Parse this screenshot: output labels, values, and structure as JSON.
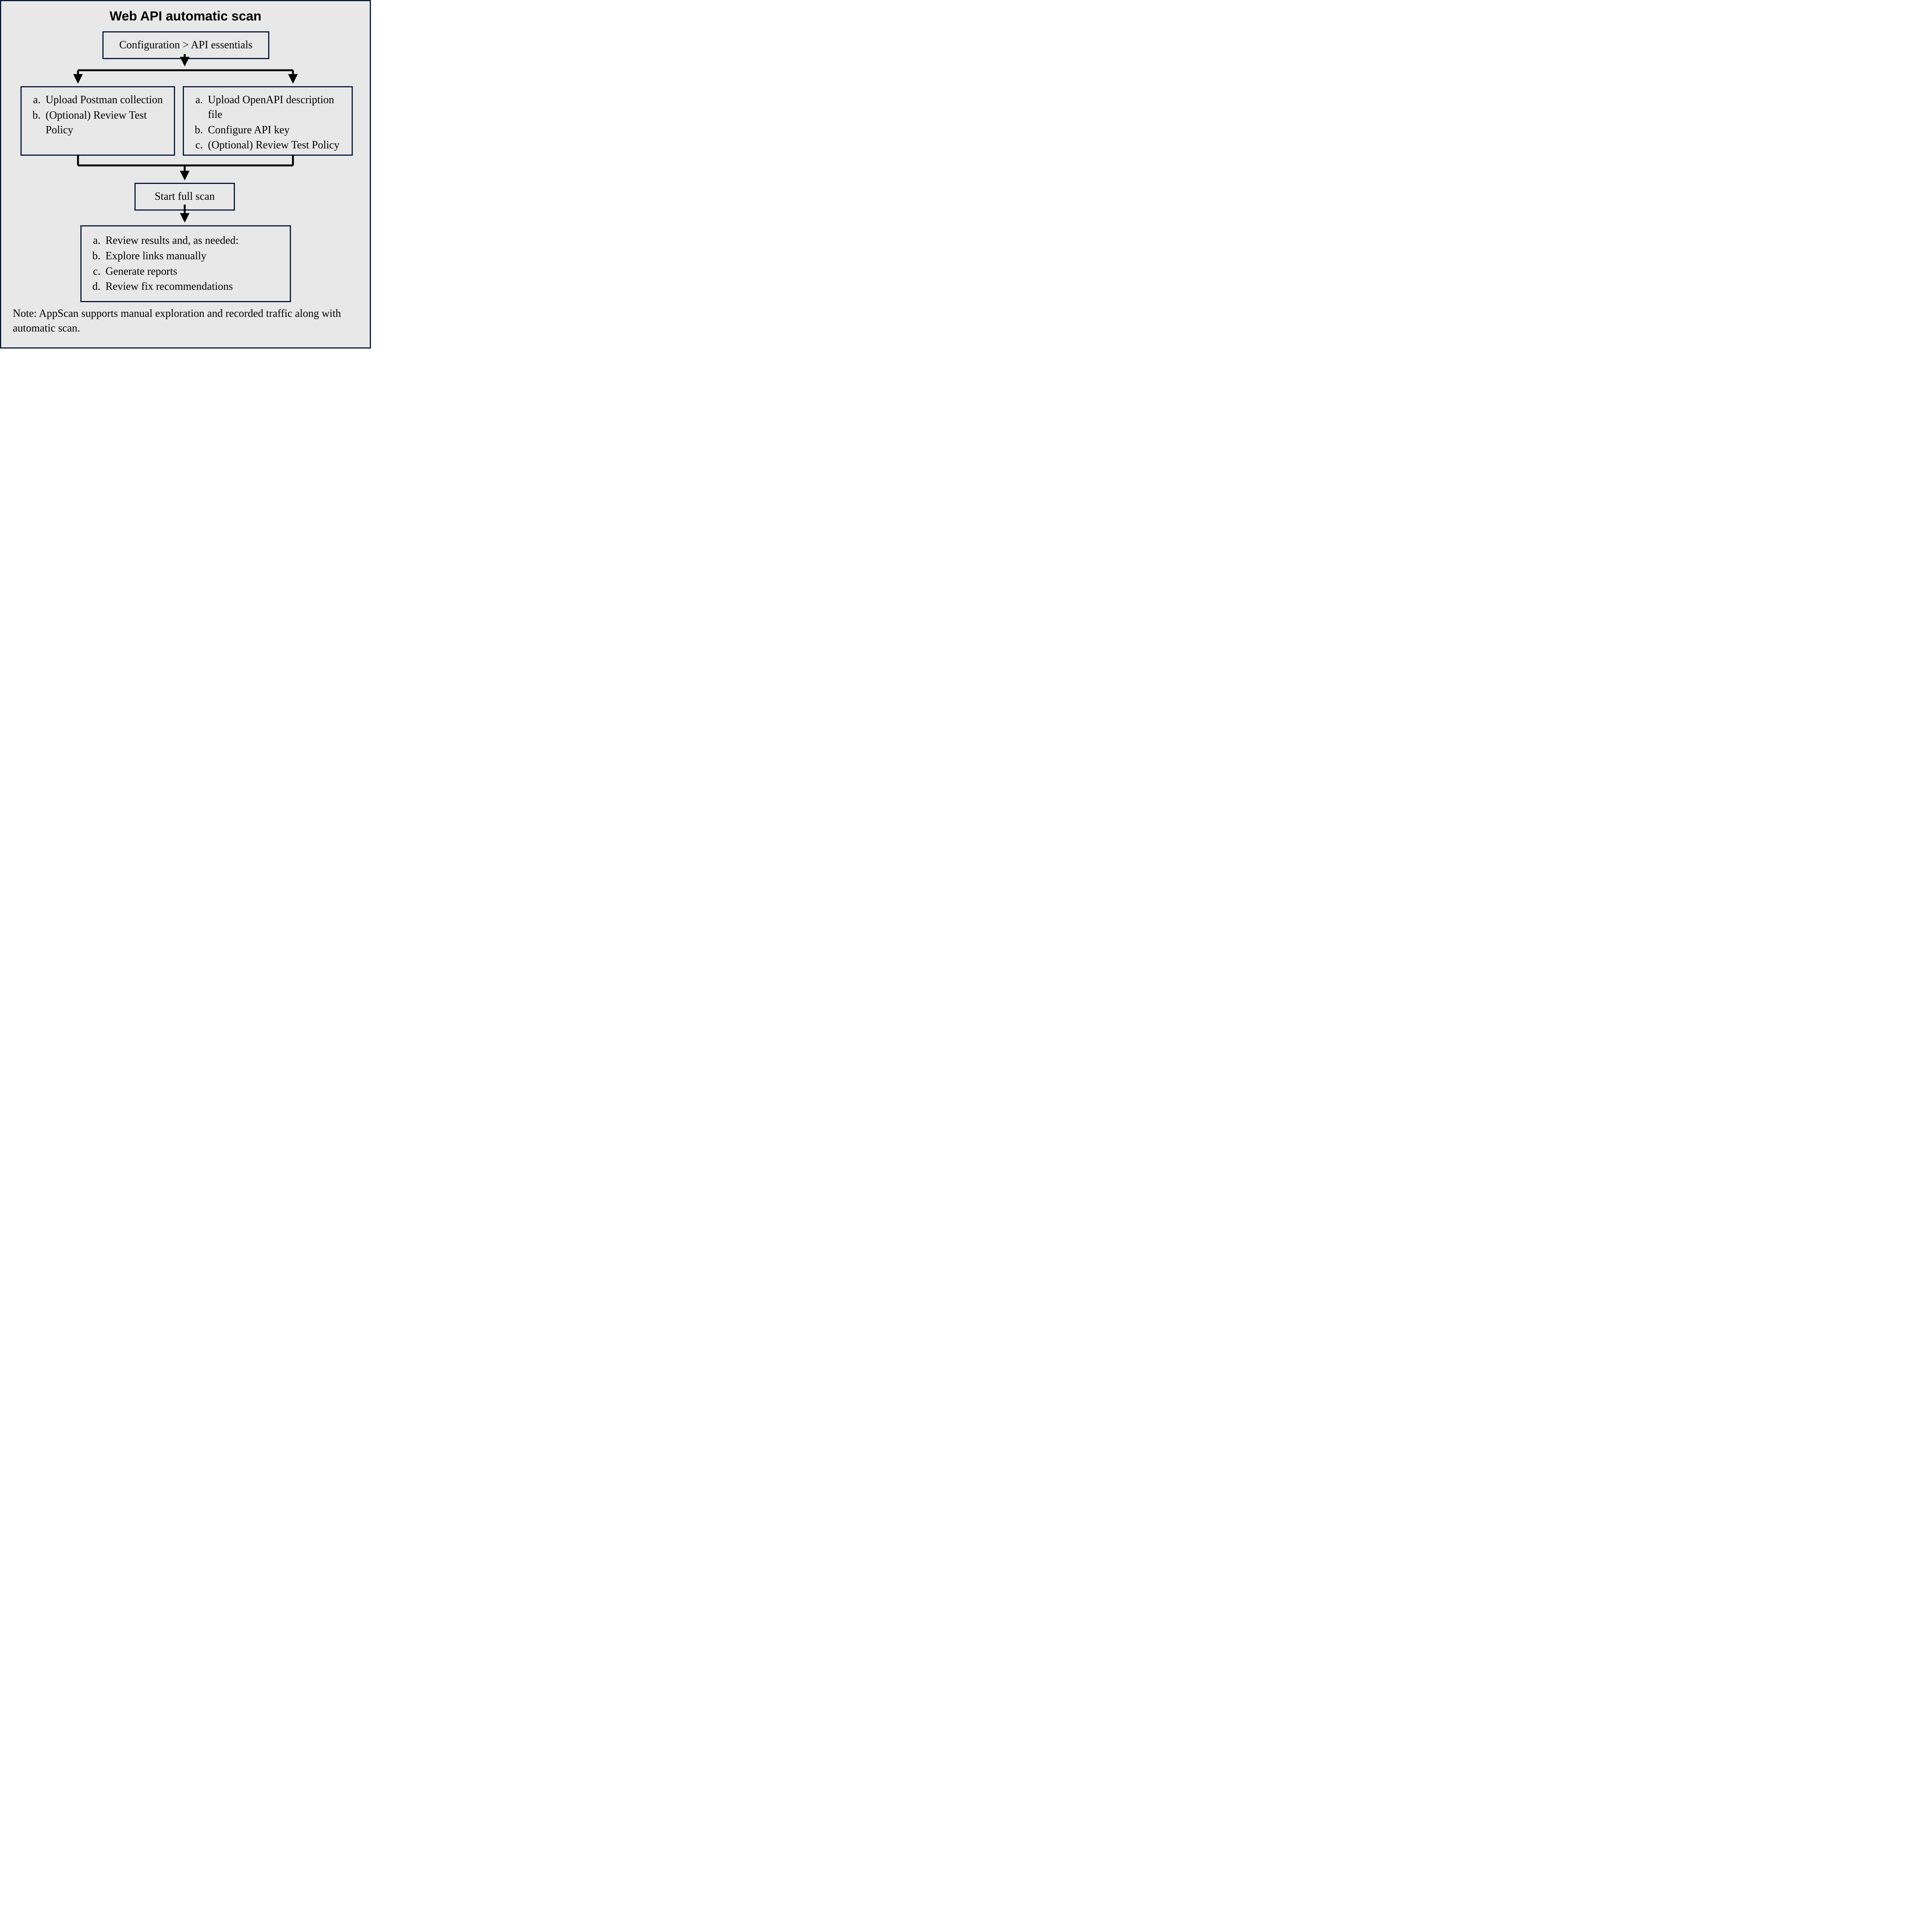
{
  "title": "Web API automatic scan",
  "configBox": "Configuration > API essentials",
  "left": {
    "a": "Upload Postman collection",
    "b": "(Optional) Review Test Policy"
  },
  "right": {
    "a": "Upload OpenAPI description file",
    "b": "Configure API key",
    "c": "(Optional) Review Test Policy"
  },
  "startBox": "Start full scan",
  "results": {
    "a": "Review results and, as needed:",
    "b": "Explore links manually",
    "c": "Generate reports",
    "d": "Review fix recommendations"
  },
  "note": "Note: AppScan supports manual exploration and recorded traffic along with automatic scan."
}
